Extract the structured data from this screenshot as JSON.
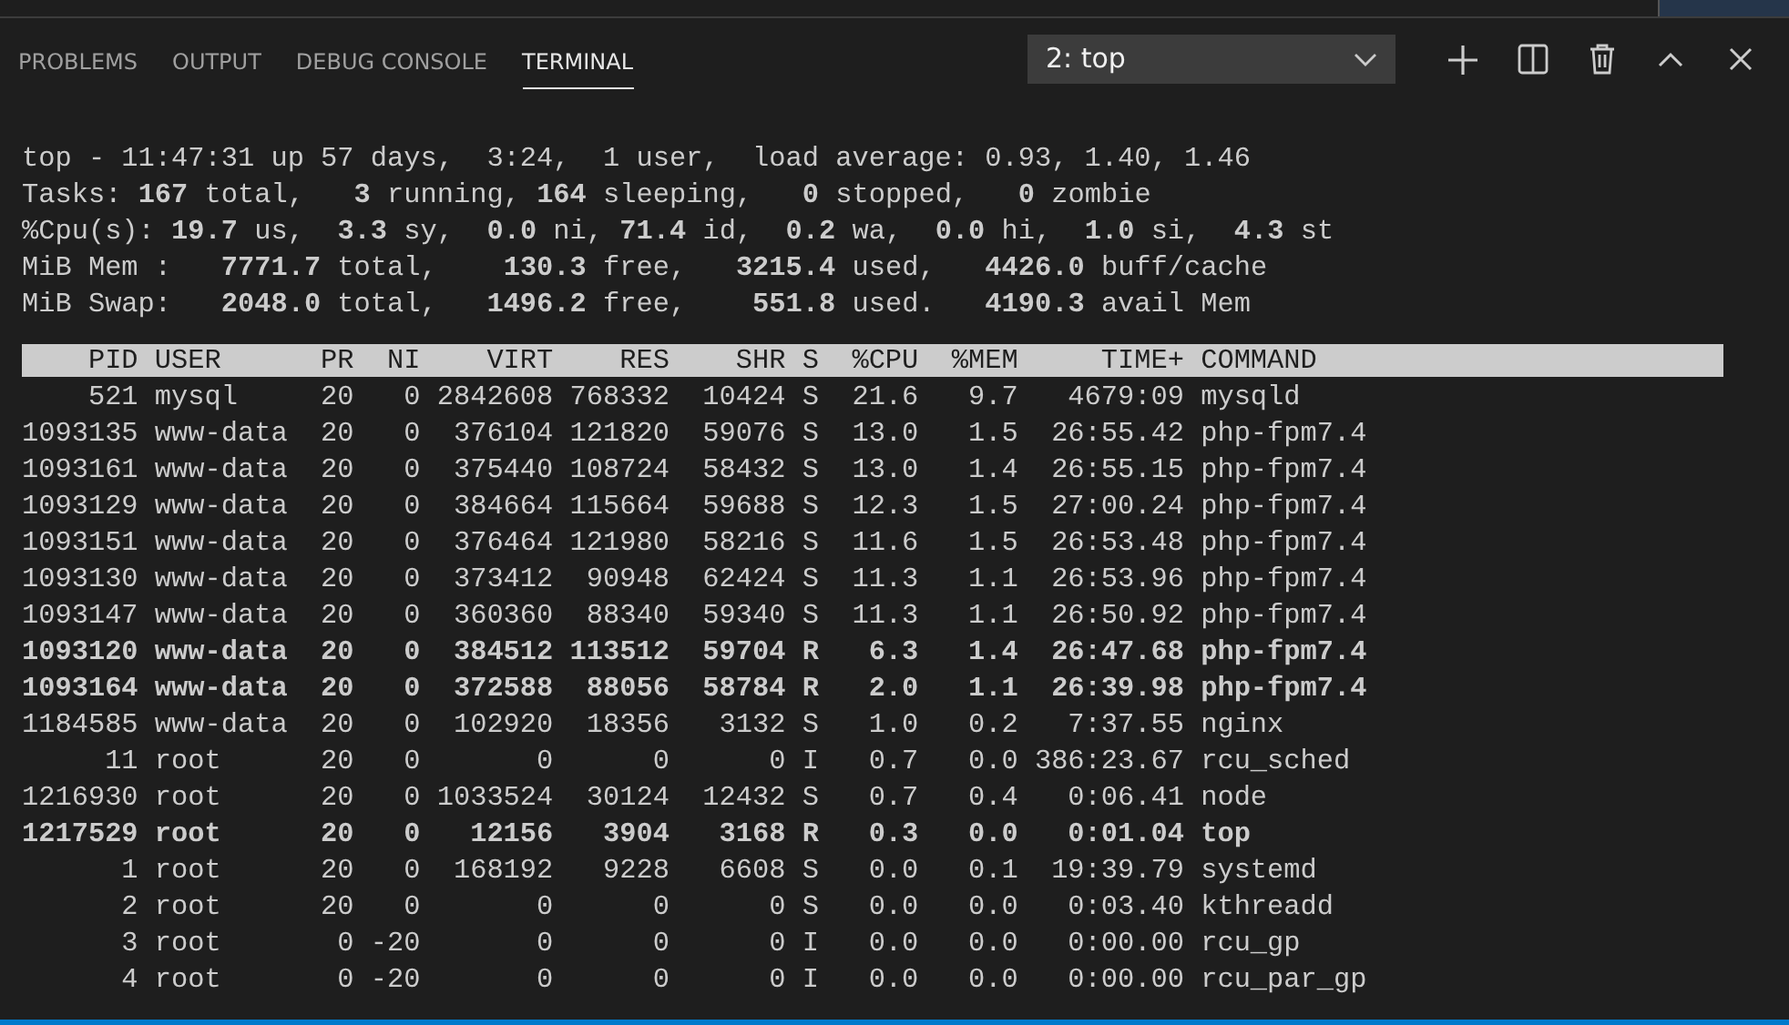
{
  "panel_tabs": [
    {
      "label": "PROBLEMS",
      "selected": false
    },
    {
      "label": "OUTPUT",
      "selected": false
    },
    {
      "label": "DEBUG CONSOLE",
      "selected": false
    },
    {
      "label": "TERMINAL",
      "selected": true
    }
  ],
  "terminal_select": {
    "value": "2: top"
  },
  "terminal": {
    "summary_lines": [
      "top - 11:47:31 up 57 days,  3:24,  1 user,  load average: 0.93, 1.40, 1.46",
      "Tasks: **167** total,   **3** running, **164** sleeping,   **0** stopped,   **0** zombie",
      "%Cpu(s): **19.7** us,  **3.3** sy,  **0.0** ni, **71.4** id,  **0.2** wa,  **0.0** hi,  **1.0** si,  **4.3** st",
      "MiB Mem :   **7771.7** total,    **130.3** free,   **3215.4** used,   **4426.0** buff/cache",
      "MiB Swap:   **2048.0** total,   **1496.2** free,    **551.8** used.   **4190.3** avail Mem"
    ],
    "columns": [
      "PID",
      "USER",
      "PR",
      "NI",
      "VIRT",
      "RES",
      "SHR",
      "S",
      "%CPU",
      "%MEM",
      "TIME+",
      "COMMAND"
    ],
    "rows": [
      {
        "cells": [
          "521",
          "mysql",
          "20",
          "0",
          "2842608",
          "768332",
          "10424",
          "S",
          "21.6",
          "9.7",
          "4679:09",
          "mysqld"
        ],
        "bold": false
      },
      {
        "cells": [
          "1093135",
          "www-data",
          "20",
          "0",
          "376104",
          "121820",
          "59076",
          "S",
          "13.0",
          "1.5",
          "26:55.42",
          "php-fpm7.4"
        ],
        "bold": false
      },
      {
        "cells": [
          "1093161",
          "www-data",
          "20",
          "0",
          "375440",
          "108724",
          "58432",
          "S",
          "13.0",
          "1.4",
          "26:55.15",
          "php-fpm7.4"
        ],
        "bold": false
      },
      {
        "cells": [
          "1093129",
          "www-data",
          "20",
          "0",
          "384664",
          "115664",
          "59688",
          "S",
          "12.3",
          "1.5",
          "27:00.24",
          "php-fpm7.4"
        ],
        "bold": false
      },
      {
        "cells": [
          "1093151",
          "www-data",
          "20",
          "0",
          "376464",
          "121980",
          "58216",
          "S",
          "11.6",
          "1.5",
          "26:53.48",
          "php-fpm7.4"
        ],
        "bold": false
      },
      {
        "cells": [
          "1093130",
          "www-data",
          "20",
          "0",
          "373412",
          "90948",
          "62424",
          "S",
          "11.3",
          "1.1",
          "26:53.96",
          "php-fpm7.4"
        ],
        "bold": false
      },
      {
        "cells": [
          "1093147",
          "www-data",
          "20",
          "0",
          "360360",
          "88340",
          "59340",
          "S",
          "11.3",
          "1.1",
          "26:50.92",
          "php-fpm7.4"
        ],
        "bold": false
      },
      {
        "cells": [
          "1093120",
          "www-data",
          "20",
          "0",
          "384512",
          "113512",
          "59704",
          "R",
          "6.3",
          "1.4",
          "26:47.68",
          "php-fpm7.4"
        ],
        "bold": true
      },
      {
        "cells": [
          "1093164",
          "www-data",
          "20",
          "0",
          "372588",
          "88056",
          "58784",
          "R",
          "2.0",
          "1.1",
          "26:39.98",
          "php-fpm7.4"
        ],
        "bold": true
      },
      {
        "cells": [
          "1184585",
          "www-data",
          "20",
          "0",
          "102920",
          "18356",
          "3132",
          "S",
          "1.0",
          "0.2",
          "7:37.55",
          "nginx"
        ],
        "bold": false
      },
      {
        "cells": [
          "11",
          "root",
          "20",
          "0",
          "0",
          "0",
          "0",
          "I",
          "0.7",
          "0.0",
          "386:23.67",
          "rcu_sched"
        ],
        "bold": false
      },
      {
        "cells": [
          "1216930",
          "root",
          "20",
          "0",
          "1033524",
          "30124",
          "12432",
          "S",
          "0.7",
          "0.4",
          "0:06.41",
          "node"
        ],
        "bold": false
      },
      {
        "cells": [
          "1217529",
          "root",
          "20",
          "0",
          "12156",
          "3904",
          "3168",
          "R",
          "0.3",
          "0.0",
          "0:01.04",
          "top"
        ],
        "bold": true
      },
      {
        "cells": [
          "1",
          "root",
          "20",
          "0",
          "168192",
          "9228",
          "6608",
          "S",
          "0.0",
          "0.1",
          "19:39.79",
          "systemd"
        ],
        "bold": false
      },
      {
        "cells": [
          "2",
          "root",
          "20",
          "0",
          "0",
          "0",
          "0",
          "S",
          "0.0",
          "0.0",
          "0:03.40",
          "kthreadd"
        ],
        "bold": false
      },
      {
        "cells": [
          "3",
          "root",
          "0",
          "-20",
          "0",
          "0",
          "0",
          "I",
          "0.0",
          "0.0",
          "0:00.00",
          "rcu_gp"
        ],
        "bold": false
      },
      {
        "cells": [
          "4",
          "root",
          "0",
          "-20",
          "0",
          "0",
          "0",
          "I",
          "0.0",
          "0.0",
          "0:00.00",
          "rcu_par_gp"
        ],
        "bold": false
      }
    ]
  }
}
